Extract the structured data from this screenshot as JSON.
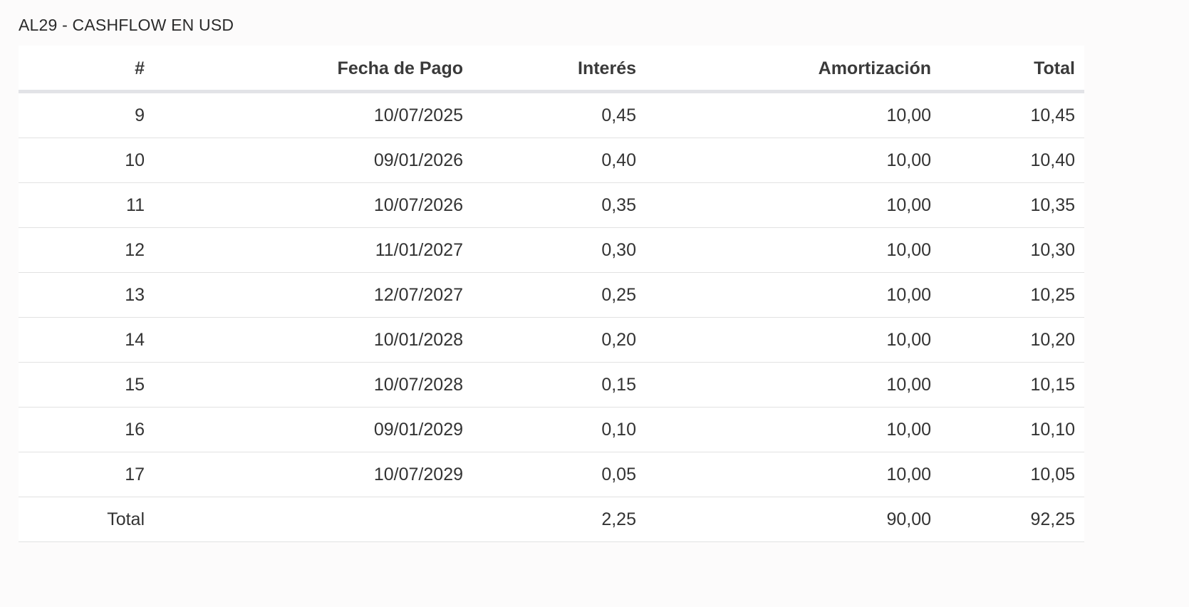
{
  "title": "AL29 - CASHFLOW EN USD",
  "table": {
    "headers": [
      "#",
      "Fecha de Pago",
      "Interés",
      "Amortización",
      "Total"
    ],
    "rows": [
      {
        "num": "9",
        "fecha": "10/07/2025",
        "interes": "0,45",
        "amortizacion": "10,00",
        "total": "10,45"
      },
      {
        "num": "10",
        "fecha": "09/01/2026",
        "interes": "0,40",
        "amortizacion": "10,00",
        "total": "10,40"
      },
      {
        "num": "11",
        "fecha": "10/07/2026",
        "interes": "0,35",
        "amortizacion": "10,00",
        "total": "10,35"
      },
      {
        "num": "12",
        "fecha": "11/01/2027",
        "interes": "0,30",
        "amortizacion": "10,00",
        "total": "10,30"
      },
      {
        "num": "13",
        "fecha": "12/07/2027",
        "interes": "0,25",
        "amortizacion": "10,00",
        "total": "10,25"
      },
      {
        "num": "14",
        "fecha": "10/01/2028",
        "interes": "0,20",
        "amortizacion": "10,00",
        "total": "10,20"
      },
      {
        "num": "15",
        "fecha": "10/07/2028",
        "interes": "0,15",
        "amortizacion": "10,00",
        "total": "10,15"
      },
      {
        "num": "16",
        "fecha": "09/01/2029",
        "interes": "0,10",
        "amortizacion": "10,00",
        "total": "10,10"
      },
      {
        "num": "17",
        "fecha": "10/07/2029",
        "interes": "0,05",
        "amortizacion": "10,00",
        "total": "10,05"
      }
    ],
    "totals": {
      "label": "Total",
      "fecha": "",
      "interes": "2,25",
      "amortizacion": "90,00",
      "total": "92,25"
    }
  }
}
